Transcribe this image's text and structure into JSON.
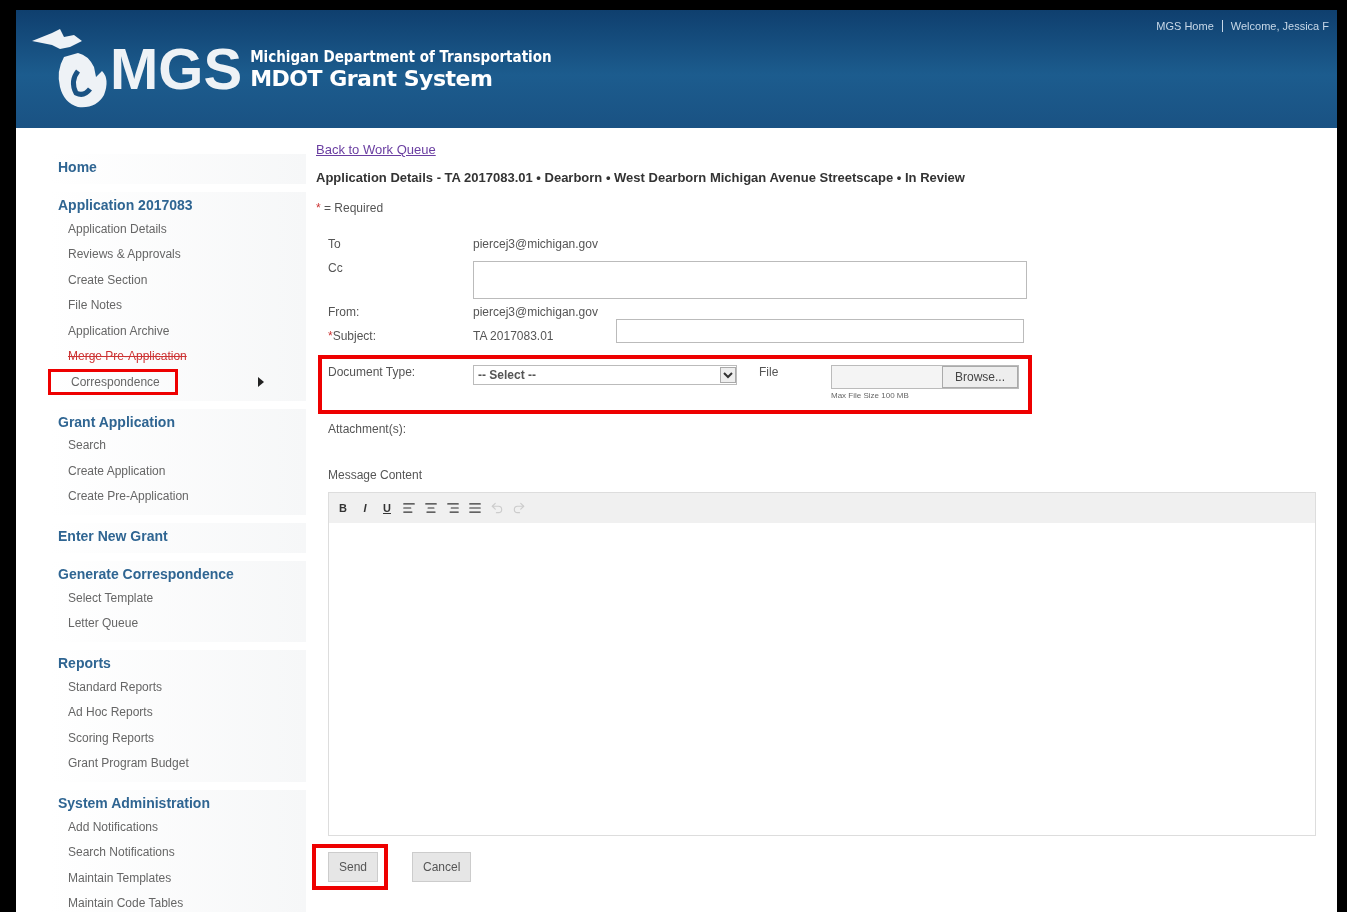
{
  "header": {
    "logo_text": "MGS",
    "agency": "Michigan Department of Transportation",
    "system": "MDOT Grant System",
    "links": [
      "MGS Home",
      "Welcome, Jessica F"
    ]
  },
  "sidebar": {
    "groups": [
      {
        "title": "Home"
      },
      {
        "title": "Application 2017083",
        "items": [
          {
            "label": "Application Details",
            "struck": false,
            "highlighted": false,
            "expanded": false
          },
          {
            "label": "Reviews & Approvals",
            "struck": false,
            "highlighted": false,
            "expanded": false
          },
          {
            "label": "Create Section",
            "struck": false,
            "highlighted": false,
            "expanded": false
          },
          {
            "label": "File Notes",
            "struck": false,
            "highlighted": false,
            "expanded": false
          },
          {
            "label": "Application Archive",
            "struck": false,
            "highlighted": false,
            "expanded": false
          },
          {
            "label": "Merge Pre-Application",
            "struck": true,
            "highlighted": false,
            "expanded": false
          },
          {
            "label": "Correspondence",
            "struck": false,
            "highlighted": true,
            "expanded": true
          }
        ]
      },
      {
        "title": "Grant Application",
        "items": [
          {
            "label": "Search",
            "struck": false,
            "highlighted": false,
            "expanded": false
          },
          {
            "label": "Create Application",
            "struck": false,
            "highlighted": false,
            "expanded": false
          },
          {
            "label": "Create Pre-Application",
            "struck": false,
            "highlighted": false,
            "expanded": false
          }
        ]
      },
      {
        "title": "Enter New Grant"
      },
      {
        "title": "Generate Correspondence",
        "items": [
          {
            "label": "Select Template",
            "struck": false,
            "highlighted": false,
            "expanded": false
          },
          {
            "label": "Letter Queue",
            "struck": false,
            "highlighted": false,
            "expanded": false
          }
        ]
      },
      {
        "title": "Reports",
        "items": [
          {
            "label": "Standard Reports",
            "struck": false,
            "highlighted": false,
            "expanded": false
          },
          {
            "label": "Ad Hoc Reports",
            "struck": false,
            "highlighted": false,
            "expanded": false
          },
          {
            "label": "Scoring Reports",
            "struck": false,
            "highlighted": false,
            "expanded": false
          },
          {
            "label": "Grant Program Budget",
            "struck": false,
            "highlighted": false,
            "expanded": false
          }
        ]
      },
      {
        "title": "System Administration",
        "items": [
          {
            "label": "Add Notifications",
            "struck": false,
            "highlighted": false,
            "expanded": false
          },
          {
            "label": "Search Notifications",
            "struck": false,
            "highlighted": false,
            "expanded": false
          },
          {
            "label": "Maintain Templates",
            "struck": false,
            "highlighted": false,
            "expanded": false
          },
          {
            "label": "Maintain Code Tables",
            "struck": false,
            "highlighted": false,
            "expanded": false
          }
        ]
      }
    ]
  },
  "main": {
    "back_link": "Back to Work Queue",
    "heading": "Application Details - TA 2017083.01 • Dearborn • West Dearborn Michigan Avenue Streetscape • In Review",
    "required_mark": "*",
    "required_note": "= Required",
    "to": {
      "label": "To",
      "value": "piercej3@michigan.gov"
    },
    "cc": {
      "label": "Cc"
    },
    "from": {
      "label": "From:",
      "value": "piercej3@michigan.gov"
    },
    "subject": {
      "label": "Subject:",
      "required": true,
      "value": "TA 2017083.01"
    },
    "document_type": {
      "label": "Document Type:",
      "value": "-- Select --",
      "highlighted": true
    },
    "file": {
      "label": "File",
      "button": "Browse...",
      "note": "Max File Size 100 MB"
    },
    "attachments": {
      "label": "Attachment(s):"
    },
    "message": {
      "label": "Message Content",
      "toolbar": [
        {
          "kind": "bold",
          "label": "B",
          "disabled": false
        },
        {
          "kind": "italic",
          "label": "I",
          "disabled": false
        },
        {
          "kind": "underline",
          "label": "U",
          "disabled": false
        },
        {
          "kind": "align-left",
          "disabled": false
        },
        {
          "kind": "align-center",
          "disabled": false
        },
        {
          "kind": "align-right",
          "disabled": false
        },
        {
          "kind": "justify",
          "disabled": false
        },
        {
          "kind": "undo",
          "disabled": true
        },
        {
          "kind": "redo",
          "disabled": true
        }
      ]
    },
    "buttons": [
      {
        "label": "Send",
        "highlighted": true
      },
      {
        "label": "Cancel",
        "highlighted": false
      }
    ]
  }
}
